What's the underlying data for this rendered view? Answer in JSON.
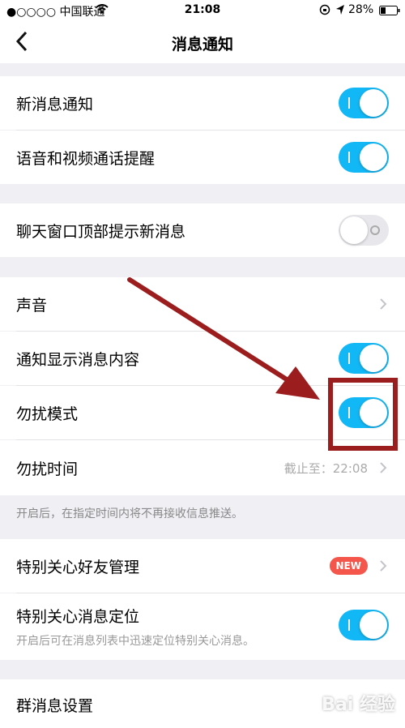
{
  "status": {
    "carrier": "●○○○○ 中国联通",
    "time": "21:08",
    "battery": "28%"
  },
  "nav": {
    "title": "消息通知"
  },
  "rows": {
    "new_msg": {
      "label": "新消息通知",
      "toggle": "on"
    },
    "voice_video": {
      "label": "语音和视频通话提醒",
      "toggle": "on"
    },
    "chat_top": {
      "label": "聊天窗口顶部提示新消息",
      "toggle": "off"
    },
    "sound": {
      "label": "声音"
    },
    "show_content": {
      "label": "通知显示消息内容",
      "toggle": "on"
    },
    "dnd_mode": {
      "label": "勿扰模式",
      "toggle": "on"
    },
    "dnd_time": {
      "label": "勿扰时间",
      "value": "截止至：22:08"
    },
    "special_friends": {
      "label": "特别关心好友管理",
      "badge": "NEW"
    },
    "special_locate": {
      "label": "特别关心消息定位",
      "subtext": "开启后可在消息列表中迅速定位特别关心消息。",
      "toggle": "on"
    },
    "group_settings": {
      "label": "群消息设置"
    }
  },
  "hints": {
    "dnd": "开启后，在指定时间内将不再接收信息推送。"
  },
  "watermark": "Bai 经验",
  "colors": {
    "toggle_on": "#12b7f5",
    "annotation": "#9c1d1d",
    "badge": "#f5564b"
  }
}
